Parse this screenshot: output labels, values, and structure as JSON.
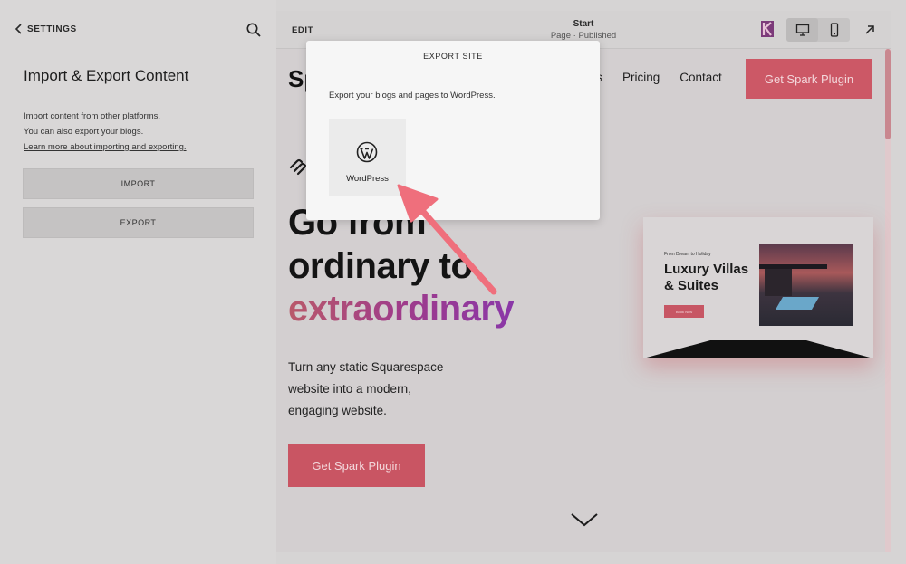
{
  "sidebar": {
    "back_label": "SETTINGS",
    "title": "Import & Export Content",
    "desc_line1": "Import content from other platforms.",
    "desc_line2": "You can also export your blogs.",
    "learn_more": "Learn more about importing and exporting.",
    "import_label": "IMPORT",
    "export_label": "EXPORT"
  },
  "topbar": {
    "edit_label": "EDIT",
    "page_title": "Start",
    "page_status": "Page · Published"
  },
  "site": {
    "logo": "Sp",
    "nav": [
      "rks",
      "Pricing",
      "Contact"
    ],
    "nav_cta": "Get Spark Plugin",
    "hero_line1": "Go from",
    "hero_line2": "ordinary to",
    "hero_line3": "extraordinary",
    "sub_line1": "Turn any static Squarespace",
    "sub_line2": "website into a modern,",
    "sub_line3": "engaging website.",
    "hero_cta": "Get Spark Plugin",
    "mock_kicker": "From Dream to Holiday",
    "mock_title_1": "Luxury Villas",
    "mock_title_2": "& Suites",
    "mock_button": "Book Now"
  },
  "dialog": {
    "title": "EXPORT SITE",
    "description": "Export your blogs and pages to WordPress.",
    "option_label": "WordPress"
  },
  "colors": {
    "accent": "#cc5866",
    "annotation_arrow": "#ef6f7c"
  }
}
